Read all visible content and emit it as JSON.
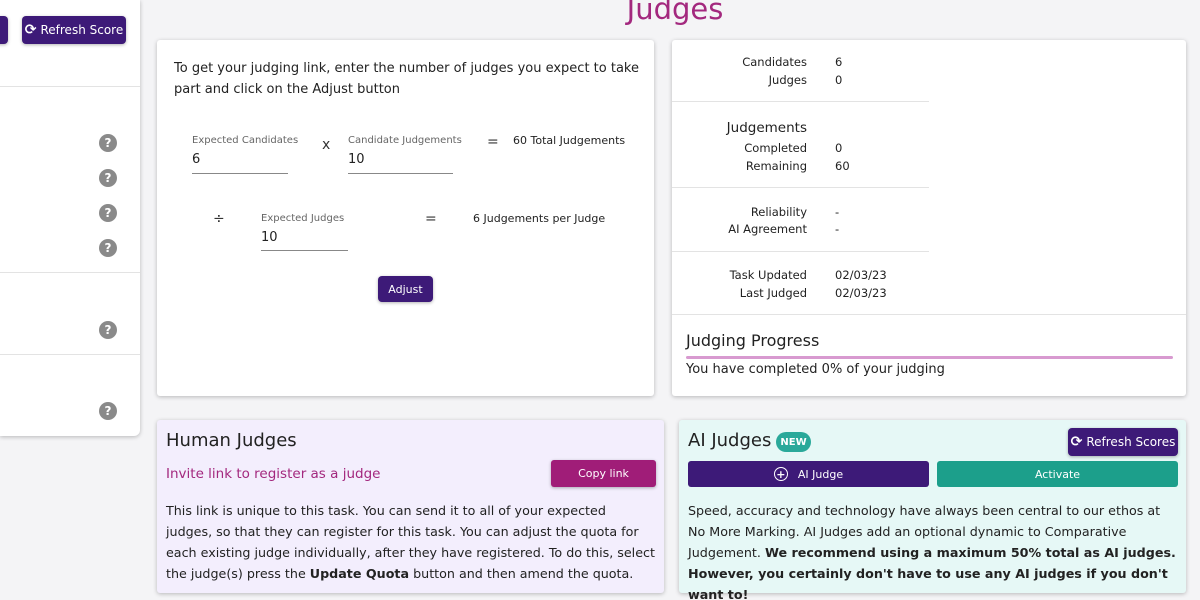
{
  "page": {
    "title": "Judges"
  },
  "sidebar": {
    "refresh_label": "Refresh Score",
    "refresh_icon": "refresh-icon",
    "help_icon": "question-circle-icon"
  },
  "calculator": {
    "intro": "To get your judging link, enter the number of judges you expect to take part and click on the Adjust button",
    "expected_candidates": {
      "label": "Expected Candidates",
      "value": "6"
    },
    "times_symbol": "x",
    "candidate_judgements": {
      "label": "Candidate Judgements",
      "value": "10"
    },
    "equals_symbol": "=",
    "total_result": "60 Total Judgements",
    "divide_symbol": "÷",
    "expected_judges": {
      "label": "Expected Judges",
      "value": "10"
    },
    "per_judge_result": "6 Judgements per Judge",
    "adjust_label": "Adjust"
  },
  "stats": {
    "candidates_label": "Candidates",
    "candidates_value": "6",
    "judges_label": "Judges",
    "judges_value": "0",
    "judgements_heading": "Judgements",
    "completed_label": "Completed",
    "completed_value": "0",
    "remaining_label": "Remaining",
    "remaining_value": "60",
    "reliability_label": "Reliability",
    "reliability_value": "-",
    "ai_agreement_label": "AI Agreement",
    "ai_agreement_value": "-",
    "task_updated_label": "Task Updated",
    "task_updated_value": "02/03/23",
    "last_judged_label": "Last Judged",
    "last_judged_value": "02/03/23"
  },
  "progress": {
    "title": "Judging Progress",
    "percent": 0,
    "text": "You have completed 0% of your judging"
  },
  "human_judges": {
    "title": "Human Judges",
    "subtitle": "Invite link to register as a judge",
    "copy_link_label": "Copy link",
    "body_part1": "This link is unique to this task. You can send it to all of your expected judges, so that they can register for this task. You can adjust the quota for each existing judge individually, after they have registered. To do this, select the judge(s) press the ",
    "body_bold": "Update Quota",
    "body_part2": " button and then amend the quota."
  },
  "ai_judges": {
    "title": "AI Judges",
    "badge": "NEW",
    "refresh_scores_label": "Refresh Scores",
    "ai_judge_label": "AI Judge",
    "activate_label": "Activate",
    "body_normal": "Speed, accuracy and technology have always been central to our ethos at No More Marking. AI Judges add an optional dynamic to Comparative Judgement. ",
    "body_bold": "We recommend using a maximum 50% total as AI judges. However, you certainly don't have to use any AI judges if you don't want to!"
  },
  "colors": {
    "brand_magenta": "#a3287e",
    "primary_purple": "#3d1a78",
    "teal": "#1c9f8b",
    "human_card_bg": "#f3eefd",
    "ai_card_bg": "#e6f8f6"
  }
}
